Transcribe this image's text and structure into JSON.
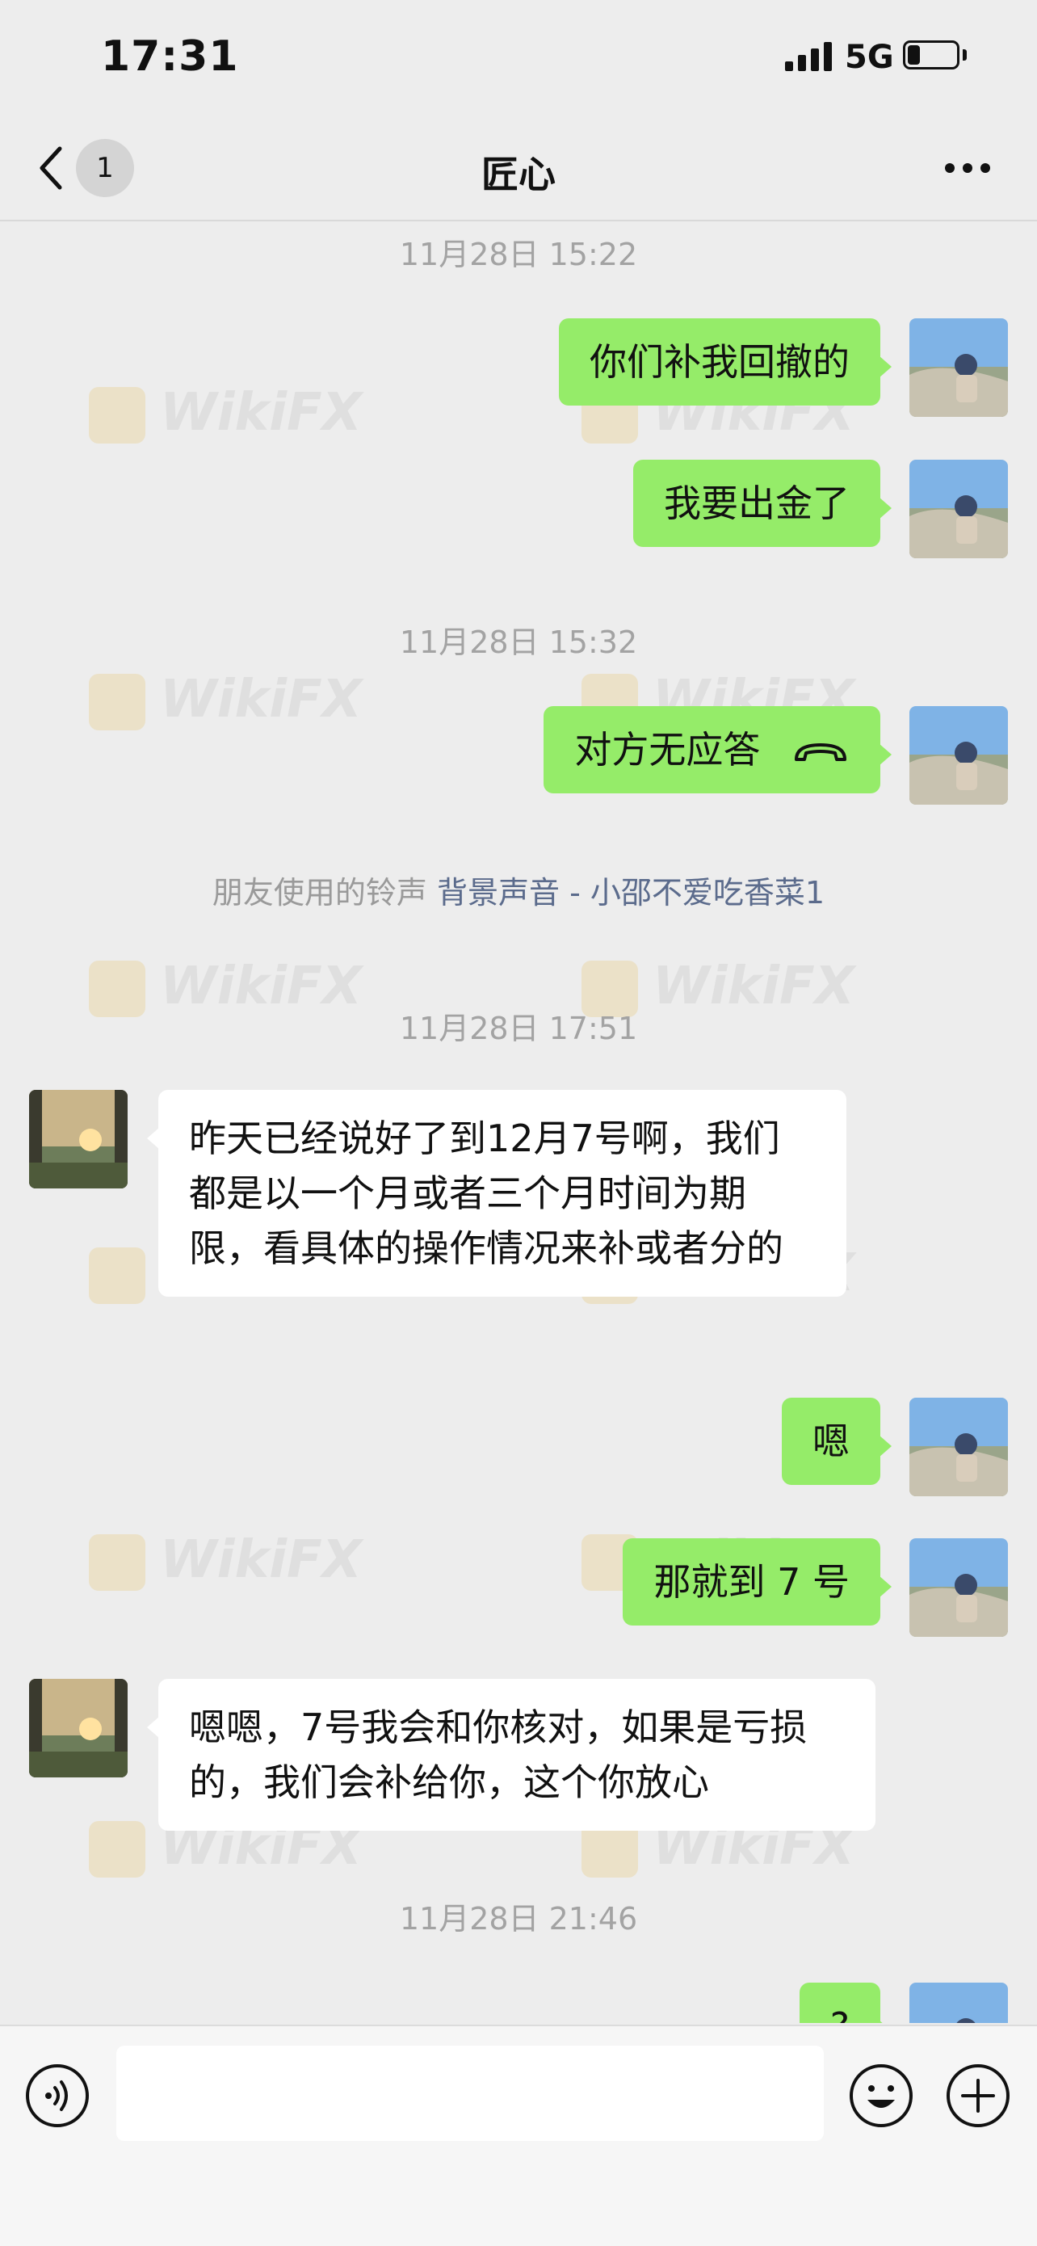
{
  "status_bar": {
    "time": "17:31",
    "network": "5G",
    "battery_level": 0.25
  },
  "nav": {
    "back_badge": "1",
    "title": "匠心",
    "more_icon": "more-dots-icon",
    "back_icon": "chevron-left-icon"
  },
  "watermark_text": "WikiFX",
  "messages": {
    "ts1": "11月28日 15:22",
    "m1": "你们补我回撤的",
    "m2": "我要出金了",
    "ts2": "11月28日 15:32",
    "m3": "对方无应答",
    "ringtone_prefix": "朋友使用的铃声",
    "ringtone_link": "背景声音 - 小邵不爱吃香菜1",
    "ts3": "11月28日 17:51",
    "m4": "昨天已经说好了到12月7号啊，我们都是以一个月或者三个月时间为期限，看具体的操作情况来补或者分的",
    "m5": "嗯",
    "m6": "那就到 7 号",
    "m7": "嗯嗯，7号我会和你核对，如果是亏损的，我们会补给你，这个你放心",
    "ts4": "11月28日 21:46",
    "m8": "?"
  },
  "input_bar": {
    "voice_icon": "voice-icon",
    "emoji_icon": "emoji-icon",
    "plus_icon": "plus-icon",
    "input_value": ""
  },
  "colors": {
    "background": "#ededed",
    "my_bubble": "#95ec69",
    "their_bubble": "#ffffff",
    "link": "#5b6b8c"
  }
}
